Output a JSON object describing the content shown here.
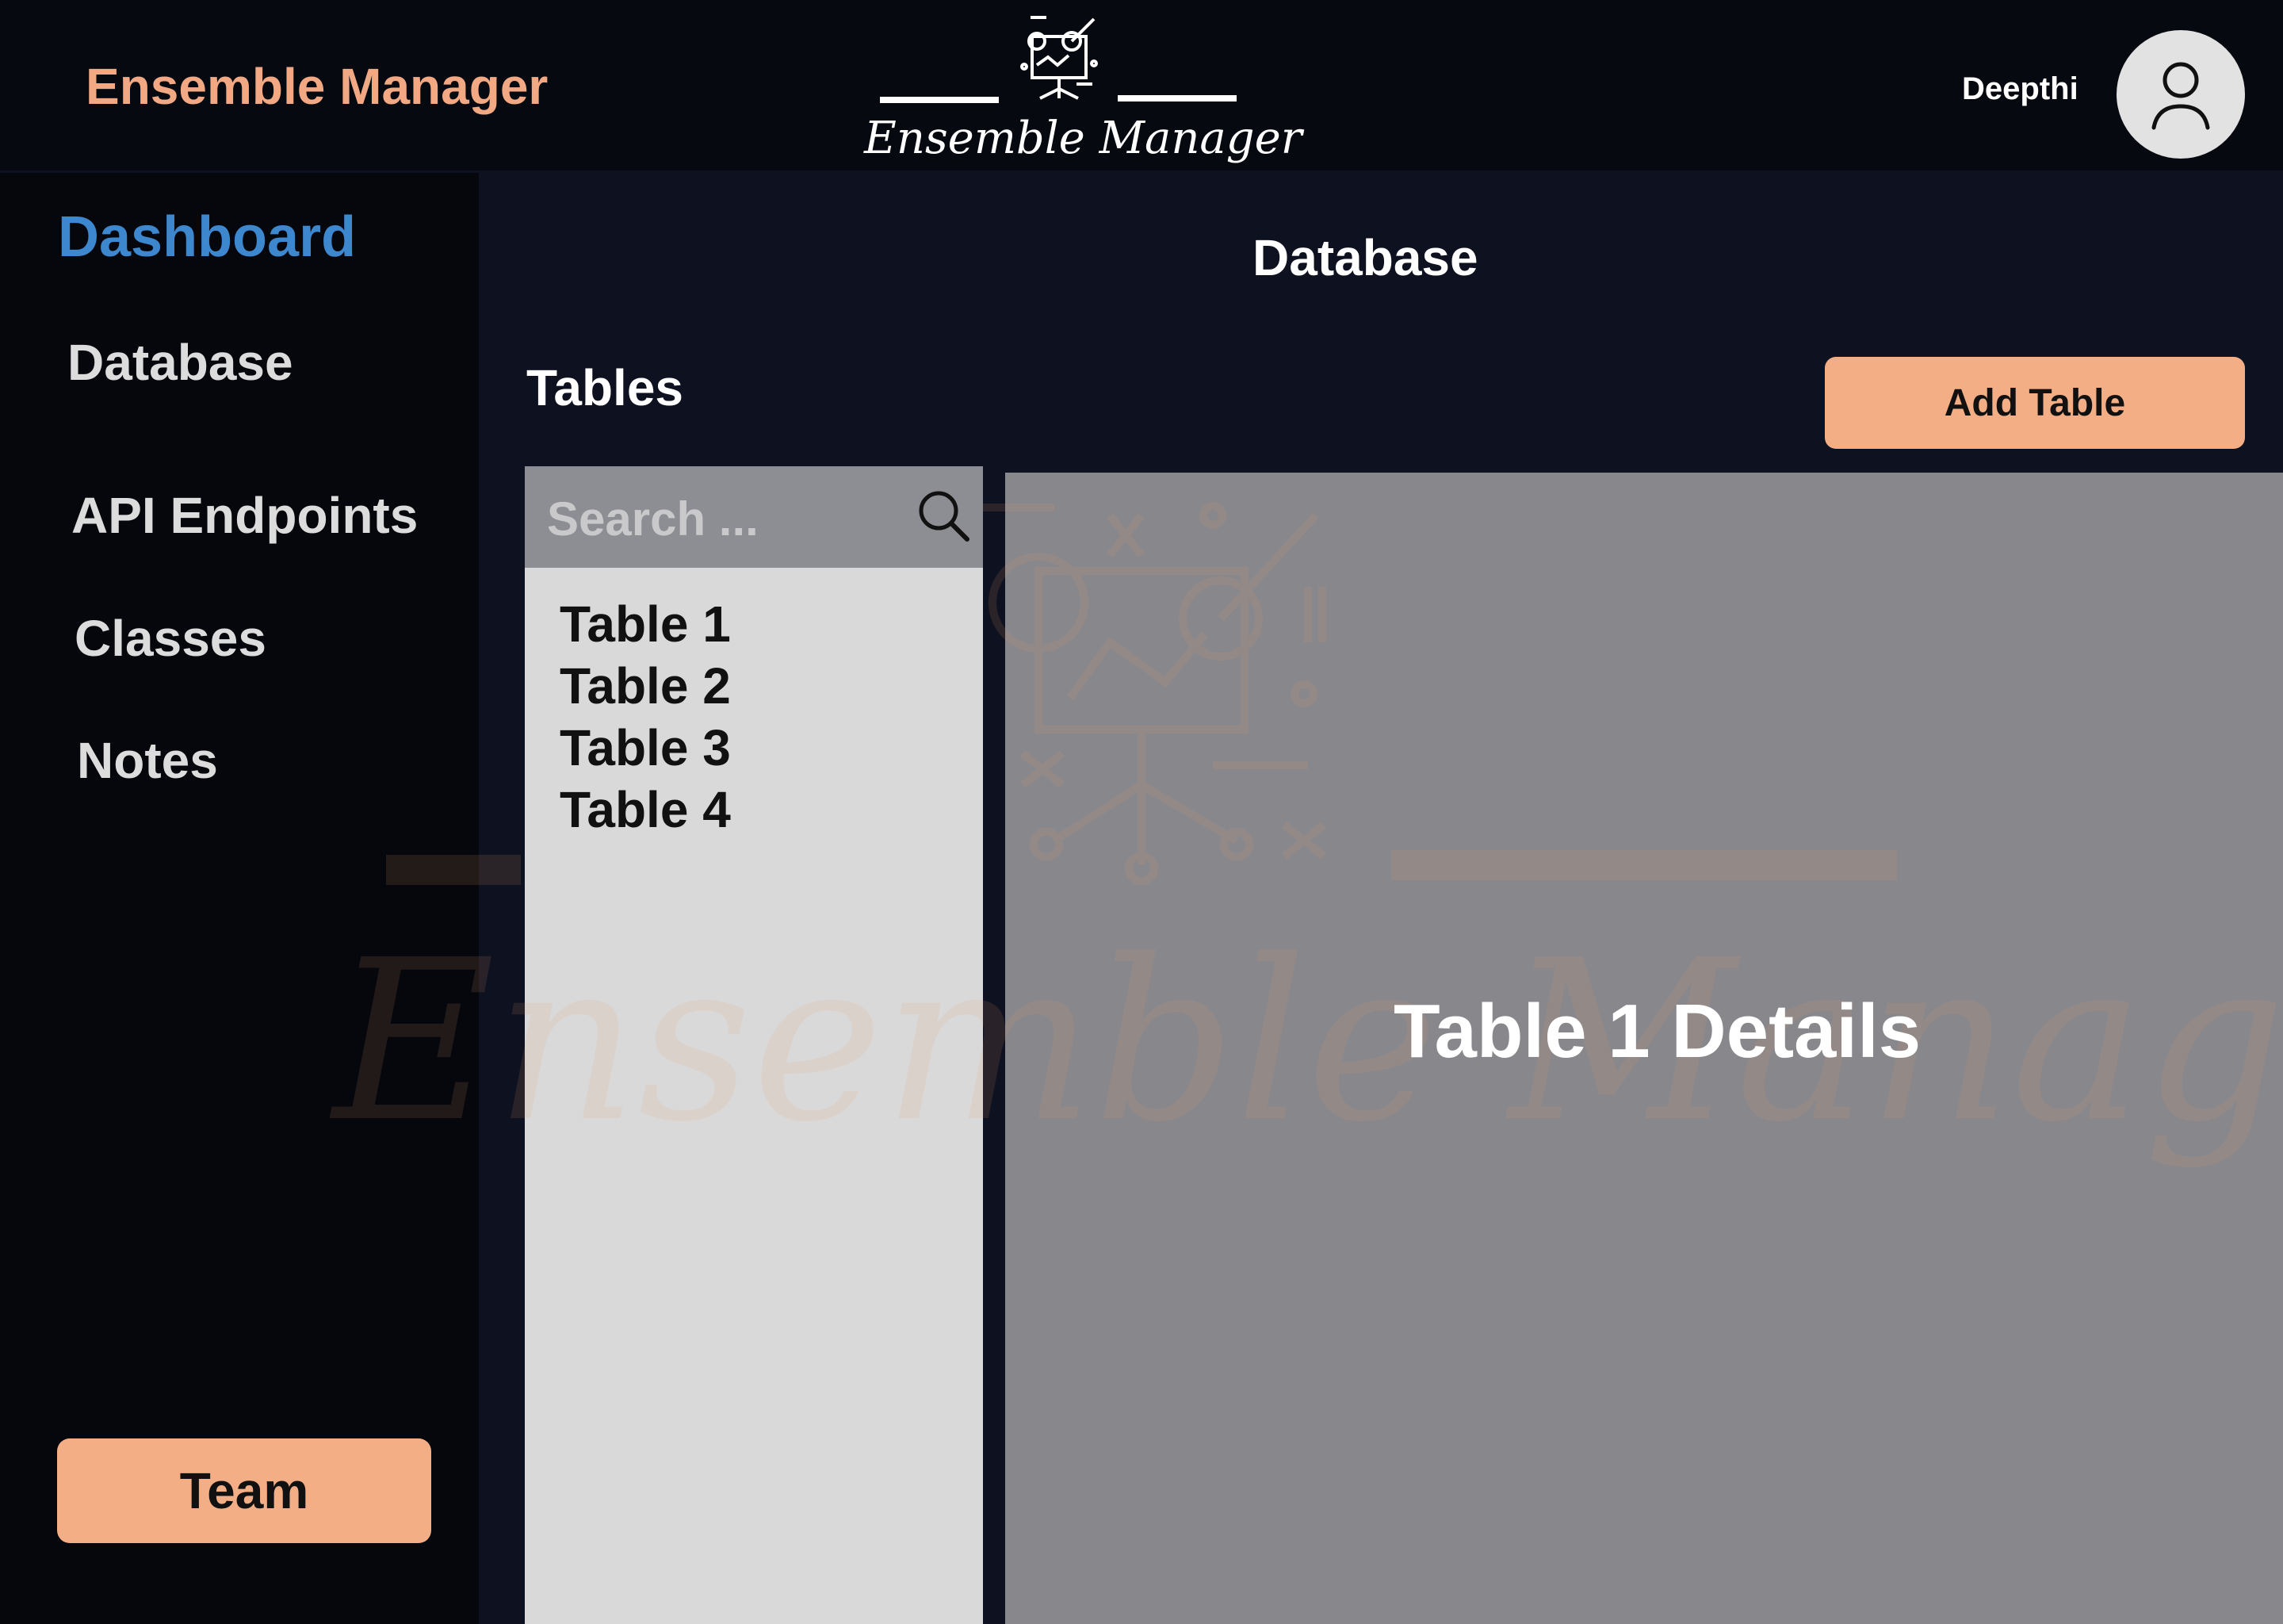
{
  "header": {
    "app_title": "Ensemble Manager",
    "logo_text": "Ensemble Manager",
    "user_name": "Deepthi",
    "avatar_icon": "user-icon"
  },
  "sidebar": {
    "items": [
      {
        "label": "Dashboard",
        "active": true
      },
      {
        "label": "Database"
      },
      {
        "label": "API Endpoints"
      },
      {
        "label": "Classes"
      },
      {
        "label": "Notes"
      }
    ],
    "team_button": "Team"
  },
  "main": {
    "page_title": "Database",
    "section_title": "Tables",
    "add_table_button": "Add Table",
    "search": {
      "placeholder": "Search ...",
      "icon": "search-icon"
    },
    "tables": [
      "Table 1",
      "Table 2",
      "Table 3",
      "Table 4"
    ],
    "details_title": "Table 1 Details"
  },
  "watermark": {
    "text": "Ensemble Manager"
  },
  "colors": {
    "accent": "#f4ae85",
    "brand_title": "#f2a983",
    "active_nav": "#3d87cf",
    "background": "#0e1220",
    "header_bg": "#070911",
    "sidebar_bg": "#05070c",
    "list_panel": "#d9d9d9",
    "details_panel": "#87878c"
  }
}
